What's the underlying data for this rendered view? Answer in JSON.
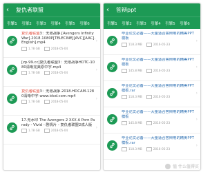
{
  "colors": {
    "accent": "#1d9a55",
    "highlight": "#e04b3a",
    "link": "#2d6fb2"
  },
  "left": {
    "title": "复仇者联盟",
    "tabs": [
      "引擎1",
      "引擎2",
      "引擎3",
      "引擎4",
      "引擎5",
      "引擎6"
    ],
    "items": [
      {
        "title_hl": "复仇者联盟",
        "title_rest": "3：无限战争.[Avengers Infinity War].2018.1080P[TELECINE][AVC][AAC].English].mp4",
        "size": "1.78 GB",
        "date": "2018-05-04"
      },
      {
        "title_hl": "",
        "title_rest": "[zp-99.cc]复仇者联盟3：无限战争HDTC-1080清晰完美原中字.mp4",
        "size": "1.78 GB",
        "date": "2018-05-04"
      },
      {
        "title_hl": "复仇者联盟",
        "title_rest": "3：无限战争.2018.HDCAM-1280清晰中字-www.idvd.com.mp4",
        "size": "1.78 GB",
        "date": "2018-05-04"
      },
      {
        "title_hl": "",
        "title_rest": "17.无水印 The Avengers 2 XXX A Porn Parody - Vivid - 剧情片 - 复仇者联盟2成人版",
        "size": "1.78 GB",
        "date": "2018-05-04"
      }
    ]
  },
  "right": {
    "title": "答辩ppt",
    "tabs": [
      "引擎1",
      "引擎2",
      "引擎3",
      "引擎4",
      "引擎5",
      "引擎6"
    ],
    "items": [
      {
        "title": "毕业论文必备——大量适合答辩用的精美PPT模板",
        "size": "118.3 MB",
        "date": "2016-05-23"
      },
      {
        "title": "毕业论文必备——大量适合答辩用的精美PPT模板",
        "size": "145.8 MB",
        "date": "2016-05-23"
      },
      {
        "title": "毕业论文必备——大量适合答辩用的精美PPT模板.rar",
        "size": "118.3 MB",
        "date": "2016-05-23"
      },
      {
        "title": "毕业论文必备——大量适合答辩用的精美PPT模板",
        "size": "145.8 MB",
        "date": "2016-05-23"
      },
      {
        "title": "毕业论文必备——大量适合答辩用的精美PPT模板.rar",
        "size": "118.3 MB",
        "date": "2016-05-23"
      }
    ]
  },
  "watermark": {
    "text": "值 什么值得买",
    "icon": "watermark-logo-icon"
  }
}
